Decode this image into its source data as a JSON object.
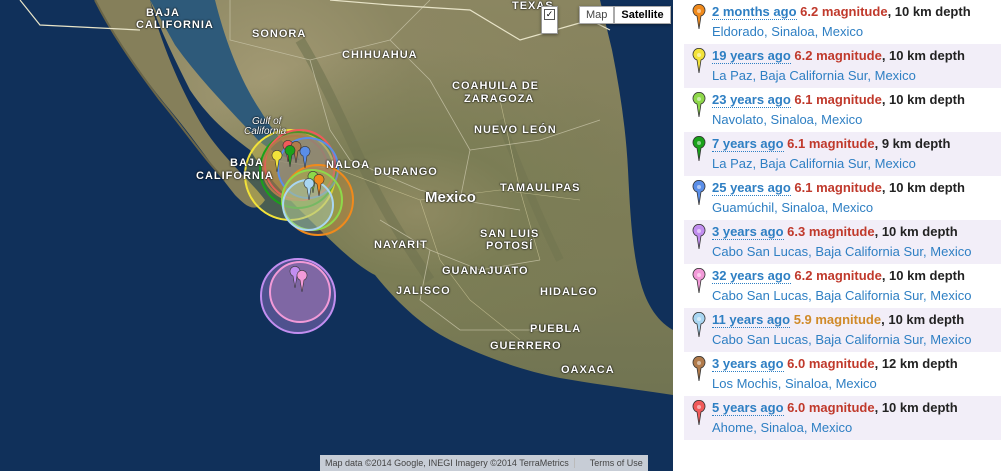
{
  "map": {
    "labels": {
      "baja_california_1": "BAJA",
      "baja_california_2": "CALIFORNIA",
      "sonora": "SONORA",
      "chihuahua": "CHIHUAHUA",
      "texas": "TEXAS",
      "coahuila_1": "COAHUILA DE",
      "coahuila_2": "ZARAGOZA",
      "nuevo_leon": "NUEVO LEÓN",
      "gulf_1": "Gulf of",
      "gulf_2": "California",
      "baja_sur_1": "BAJA",
      "baja_sur_2": "CALIFORNIA",
      "sinaloa": "NALOA",
      "durango": "DURANGO",
      "mexico": "Mexico",
      "tamaulipas": "TAMAULIPAS",
      "nayarit": "NAYARIT",
      "san_luis_1": "SAN LUIS",
      "san_luis_2": "POTOSÍ",
      "guanajuato": "GUANAJUATO",
      "jalisco": "JALISCO",
      "hidalgo": "HIDALGO",
      "puebla": "PUEBLA",
      "guerrero": "GUERRERO",
      "oaxaca": "OAXACA"
    },
    "map_type_map": "Map",
    "map_type_satellite": "Satellite",
    "checkbox_mark": "✓",
    "attribution": "Map data ©2014 Google, INEGI Imagery ©2014 TerraMetrics",
    "terms": "Terms of Use",
    "ocean_color": "#0f2a55",
    "land_color": "#857f5a"
  },
  "earthquakes": [
    {
      "pin_color": "#f08a1c",
      "when": "2 months ago",
      "magnitude": "6.2 magnitude",
      "depth": ", 10 km depth",
      "place": "Eldorado",
      "region": "Sinaloa",
      "country": "Mexico"
    },
    {
      "pin_color": "#f2e23a",
      "when": "19 years ago",
      "magnitude": "6.2 magnitude",
      "depth": ", 10 km depth",
      "place": "La Paz",
      "region": "Baja California Sur",
      "country": "Mexico"
    },
    {
      "pin_color": "#8ed84a",
      "when": "23 years ago",
      "magnitude": "6.1 magnitude",
      "depth": ", 10 km depth",
      "place": "Navolato",
      "region": "Sinaloa",
      "country": "Mexico"
    },
    {
      "pin_color": "#1aa21a",
      "when": "7 years ago",
      "magnitude": "6.1 magnitude",
      "depth": ", 9 km depth",
      "place": "La Paz",
      "region": "Baja California Sur",
      "country": "Mexico"
    },
    {
      "pin_color": "#5a8ee8",
      "when": "25 years ago",
      "magnitude": "6.1 magnitude",
      "depth": ", 10 km depth",
      "place": "Guamúchil",
      "region": "Sinaloa",
      "country": "Mexico"
    },
    {
      "pin_color": "#c28ef0",
      "when": "3 years ago",
      "magnitude": "6.3 magnitude",
      "depth": ", 10 km depth",
      "place": "Cabo San Lucas",
      "region": "Baja California Sur",
      "country": "Mexico"
    },
    {
      "pin_color": "#f29ad8",
      "when": "32 years ago",
      "magnitude": "6.2 magnitude",
      "depth": ", 10 km depth",
      "place": "Cabo San Lucas",
      "region": "Baja California Sur",
      "country": "Mexico"
    },
    {
      "pin_color": "#a9d6f2",
      "when": "11 years ago",
      "magnitude": "5.9 magnitude",
      "depth": ", 10 km depth",
      "place": "Cabo San Lucas",
      "region": "Baja California Sur",
      "country": "Mexico"
    },
    {
      "pin_color": "#b07a4a",
      "when": "3 years ago",
      "magnitude": "6.0 magnitude",
      "depth": ", 12 km depth",
      "place": "Los Mochis",
      "region": "Sinaloa",
      "country": "Mexico"
    },
    {
      "pin_color": "#f05a5a",
      "when": "5 years ago",
      "magnitude": "6.0 magnitude",
      "depth": ", 10 km depth",
      "place": "Ahome",
      "region": "Sinaloa",
      "country": "Mexico"
    }
  ],
  "colors": {
    "link": "#2e7fc3",
    "magnitude_red": "#c0392b",
    "magnitude_orange": "#d08a28",
    "row_alt": "#f2eef8"
  }
}
